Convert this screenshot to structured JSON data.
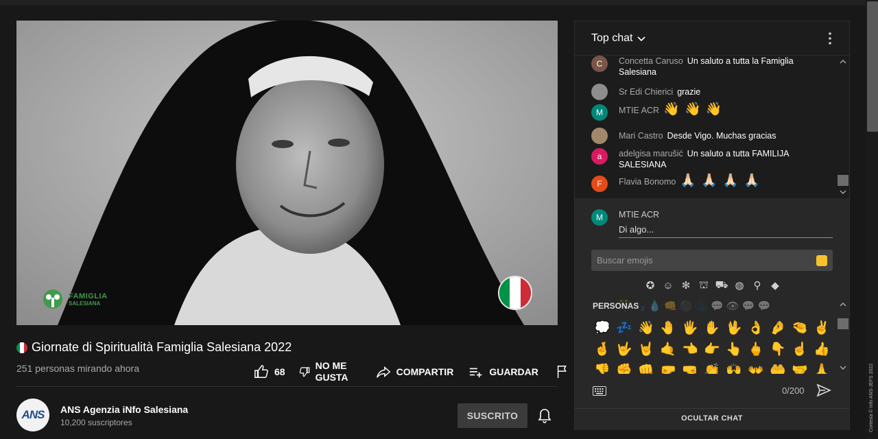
{
  "video": {
    "logo_line1": "FAMIGLIA",
    "logo_line2": "SALESIANA",
    "badge": "italy-flag"
  },
  "title": "Giornate di Spiritualità Famiglia Salesiana 2022",
  "viewers": "251 personas mirando ahora",
  "actions": {
    "like_count": "68",
    "dislike_label": "NO ME GUSTA",
    "share_label": "COMPARTIR",
    "save_label": "GUARDAR"
  },
  "channel": {
    "avatar_text": "ANS",
    "name": "ANS Agenzia iNfo Salesiana",
    "subscribers": "10,200 suscriptores",
    "subscribe_label": "SUSCRITO"
  },
  "chat": {
    "title": "Top chat",
    "messages": [
      {
        "initial": "C",
        "color": "#795548",
        "author": "Concetta Caruso",
        "text": "Un saluto a tutta la Famiglia Salesiana"
      },
      {
        "initial": "",
        "color": "#8d8d8d",
        "author": "Sr Edi Chierici",
        "text": "grazie"
      },
      {
        "initial": "M",
        "color": "#00897b",
        "author": "MTIE ACR",
        "text": "👋 👋 👋"
      },
      {
        "initial": "",
        "color": "#a0896b",
        "author": "Mari Castro",
        "text": "Desde Vigo. Muchas gracias"
      },
      {
        "initial": "a",
        "color": "#d81b60",
        "author": "adelgisa marušić",
        "text": "Un saluto a tutta FAMILIJA SALESIANA"
      },
      {
        "initial": "F",
        "color": "#e64a19",
        "author": "Flavia Bonomo",
        "text": "🙏🏻 🙏🏻 🙏🏻 🙏🏻"
      }
    ],
    "input": {
      "initial": "M",
      "color": "#00897b",
      "author": "MTIE ACR",
      "placeholder": "Di algo..."
    },
    "emoji_search_placeholder": "Buscar emojis",
    "emoji_category": "PERSONAS",
    "emoji_rows": [
      [
        "💭",
        "💤",
        "👋",
        "🤚",
        "🖐",
        "✋",
        "🖖",
        "👌",
        "🤌",
        "🤏",
        "✌"
      ],
      [
        "🤞",
        "🤟",
        "🤘",
        "🤙",
        "👈",
        "👉",
        "👆",
        "🖕",
        "👇",
        "☝",
        "👍"
      ],
      [
        "👎",
        "✊",
        "👊",
        "🤛",
        "🤜",
        "👏",
        "🙌",
        "👐",
        "🤲",
        "🤝",
        "🙏"
      ]
    ],
    "ghost_row": "🎊🐾💧👊⚫🌑💬👁💬💬",
    "counter": "0/200",
    "hide_label": "OCULTAR CHAT"
  },
  "credit": "Cortesía © Info ANS-JEFS 2022"
}
